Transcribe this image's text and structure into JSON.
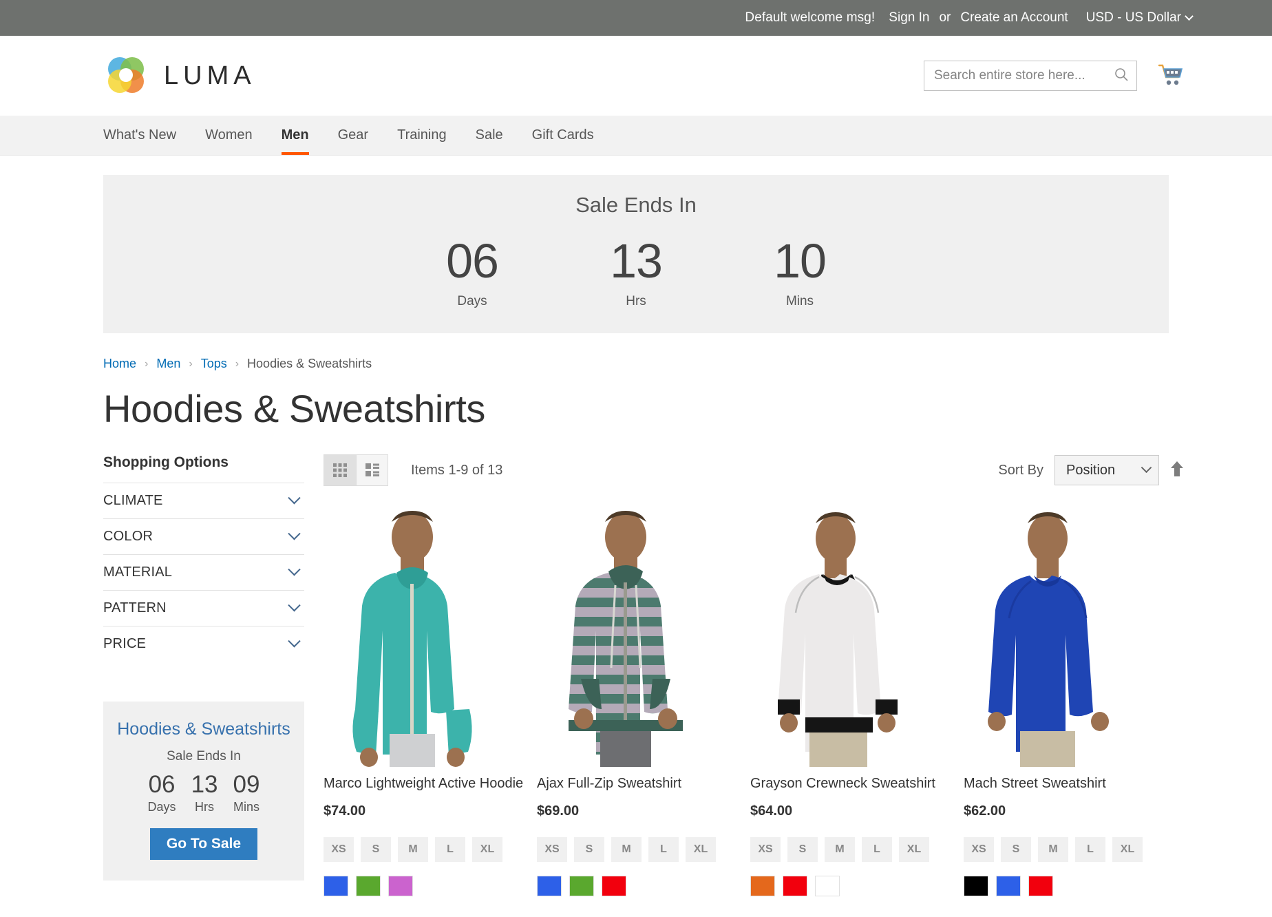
{
  "top_panel": {
    "welcome": "Default welcome msg!",
    "sign_in": "Sign In",
    "or": "or",
    "create_account": "Create an Account",
    "currency": "USD - US Dollar"
  },
  "header": {
    "logo_text": "LUMA",
    "search_placeholder": "Search entire store here...",
    "search_value": "",
    "search_icon": "search-icon",
    "cart_icon": "shopping-cart-icon"
  },
  "nav": {
    "items": [
      {
        "label": "What's New",
        "active": false
      },
      {
        "label": "Women",
        "active": false
      },
      {
        "label": "Men",
        "active": true
      },
      {
        "label": "Gear",
        "active": false
      },
      {
        "label": "Training",
        "active": false
      },
      {
        "label": "Sale",
        "active": false
      },
      {
        "label": "Gift Cards",
        "active": false
      }
    ]
  },
  "banner": {
    "title": "Sale Ends In",
    "units": [
      {
        "value": "06",
        "label": "Days"
      },
      {
        "value": "13",
        "label": "Hrs"
      },
      {
        "value": "10",
        "label": "Mins"
      }
    ]
  },
  "breadcrumb": {
    "items": [
      "Home",
      "Men",
      "Tops",
      "Hoodies & Sweatshirts"
    ],
    "separator": "›"
  },
  "page_title": "Hoodies & Sweatshirts",
  "sidebar": {
    "title": "Shopping Options",
    "filters": [
      {
        "label": "CLIMATE"
      },
      {
        "label": "COLOR"
      },
      {
        "label": "MATERIAL"
      },
      {
        "label": "PATTERN"
      },
      {
        "label": "PRICE"
      }
    ],
    "promo": {
      "title": "Hoodies & Sweatshirts",
      "subtitle": "Sale Ends In",
      "units": [
        {
          "value": "06",
          "label": "Days"
        },
        {
          "value": "13",
          "label": "Hrs"
        },
        {
          "value": "09",
          "label": "Mins"
        }
      ],
      "button": "Go To Sale",
      "button_color": "#2f7dc0",
      "title_color": "#3771ad"
    }
  },
  "toolbar": {
    "grid_mode_icon": "grid-view-icon",
    "list_mode_icon": "list-view-icon",
    "active_mode": "grid",
    "amount": "Items 1-9 of 13",
    "sort_label": "Sort By",
    "sort_value": "Position",
    "sort_direction_icon": "arrow-up-icon"
  },
  "products": [
    {
      "name": "Marco Lightweight Active Hoodie",
      "price": "$74.00",
      "sizes": [
        "XS",
        "S",
        "M",
        "L",
        "XL"
      ],
      "colors": [
        "#2d60e8",
        "#5aa82e",
        "#cb63ce"
      ],
      "image": {
        "garment": "zip-hoodie",
        "garment_color": "#3cb3ab",
        "pants_color": "#cfd0d2"
      }
    },
    {
      "name": "Ajax Full-Zip Sweatshirt",
      "price": "$69.00",
      "sizes": [
        "XS",
        "S",
        "M",
        "L",
        "XL"
      ],
      "colors": [
        "#2d60e8",
        "#5aa82e",
        "#f2000d"
      ],
      "image": {
        "garment": "striped-zip-hoodie",
        "garment_color": "#4c7a6e",
        "stripe_color": "#b4aab8",
        "pants_color": "#6d6e71"
      }
    },
    {
      "name": "Grayson Crewneck Sweatshirt",
      "price": "$64.00",
      "sizes": [
        "XS",
        "S",
        "M",
        "L",
        "XL"
      ],
      "colors": [
        "#e4681c",
        "#f2000d",
        "#ffffff"
      ],
      "image": {
        "garment": "crewneck",
        "garment_color": "#eceaea",
        "trim_color": "#111111",
        "pants_color": "#c8bda4"
      }
    },
    {
      "name": "Mach Street Sweatshirt",
      "price": "$62.00",
      "sizes": [
        "XS",
        "S",
        "M",
        "L",
        "XL"
      ],
      "colors": [
        "#000000",
        "#2d60e8",
        "#f2000d"
      ],
      "image": {
        "garment": "long-sleeve-tee",
        "garment_color": "#1f45b4",
        "pants_color": "#c8bda4"
      }
    }
  ],
  "colors": {
    "accent": "#ff5501",
    "link": "#006bb4",
    "top_bar": "#6e716e",
    "banner_bg": "#f0f0f0"
  }
}
